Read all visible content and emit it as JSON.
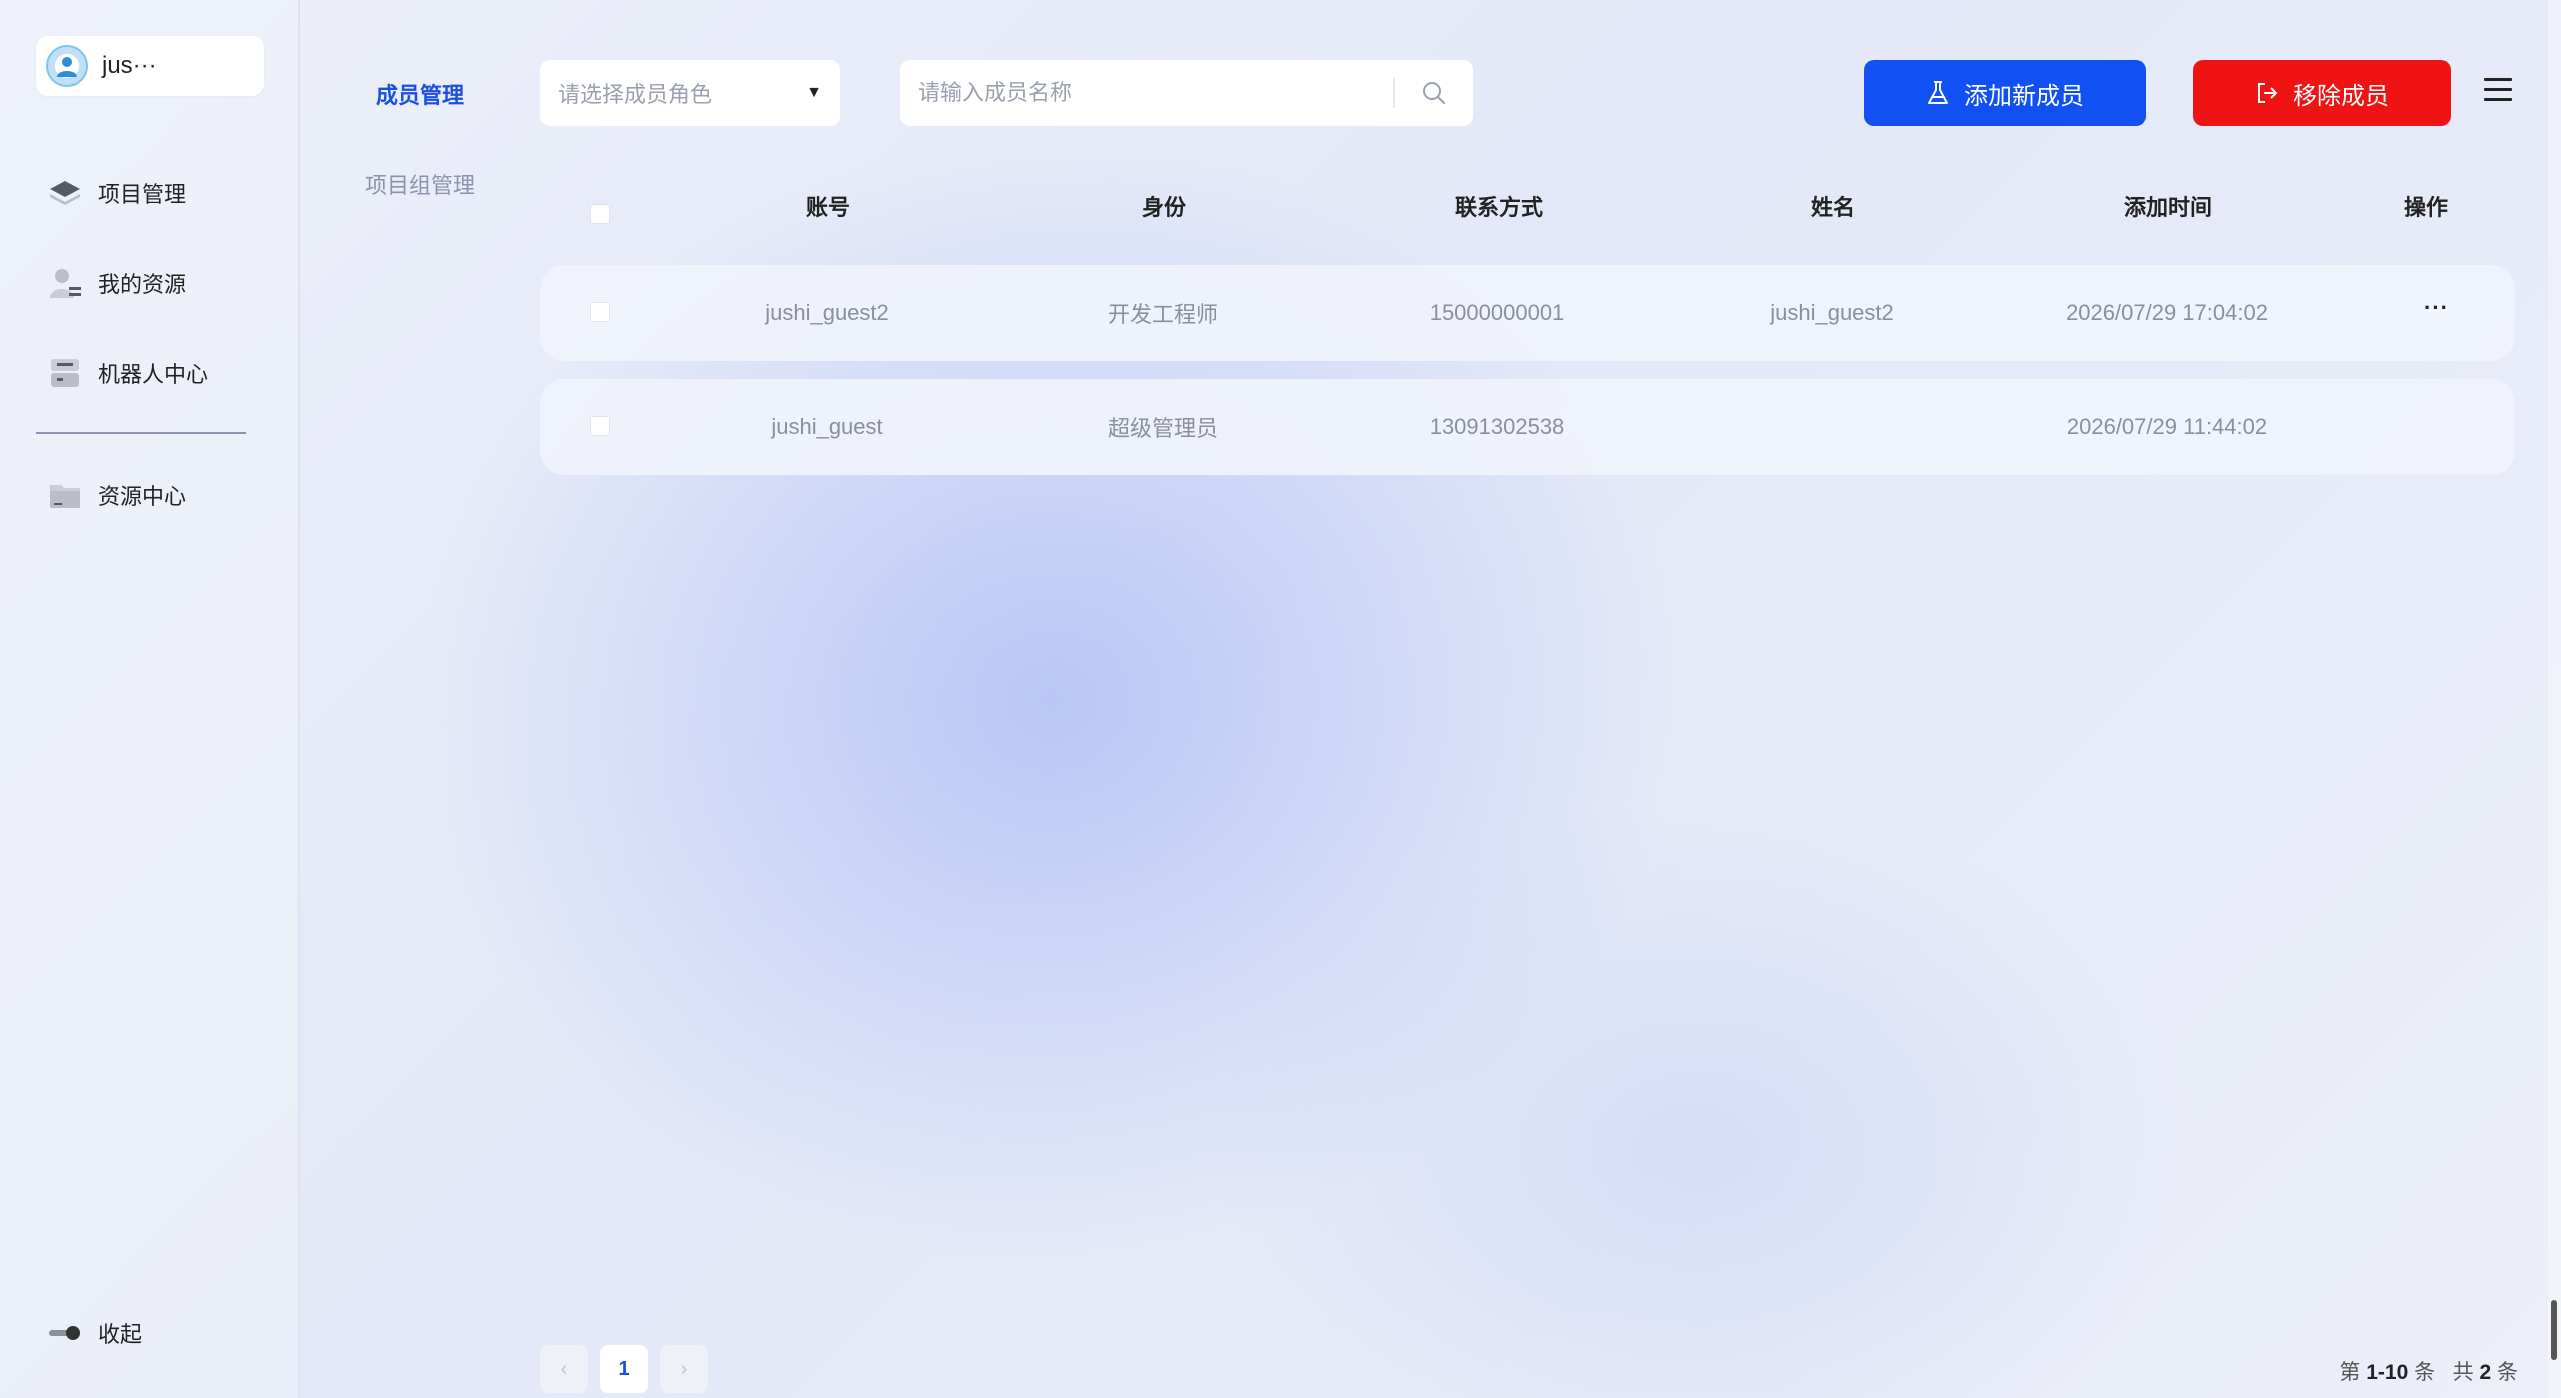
{
  "user": {
    "name": "jus···"
  },
  "sidebar": {
    "items": [
      {
        "label": "项目管理",
        "icon": "layers-icon"
      },
      {
        "label": "我的资源",
        "icon": "user-resource-icon"
      },
      {
        "label": "机器人中心",
        "icon": "robot-icon"
      },
      {
        "label": "资源中心",
        "icon": "folder-icon"
      }
    ],
    "collapse_label": "收起"
  },
  "sub_nav": {
    "items": [
      {
        "label": "成员管理",
        "active": true
      },
      {
        "label": "项目组管理",
        "active": false
      }
    ]
  },
  "toolbar": {
    "role_select_placeholder": "请选择成员角色",
    "search_placeholder": "请输入成员名称",
    "add_label": "添加新成员",
    "remove_label": "移除成员"
  },
  "table": {
    "columns": [
      "账号",
      "身份",
      "联系方式",
      "姓名",
      "添加时间",
      "操作"
    ],
    "rows": [
      {
        "account": "jushi_guest2",
        "role": "开发工程师",
        "contact": "15000000001",
        "name": "jushi_guest2",
        "added": "2026/07/29 17:04:02",
        "action": "···"
      },
      {
        "account": "jushi_guest",
        "role": "超级管理员",
        "contact": "13091302538",
        "name": "",
        "added": "2026/07/29 11:44:02",
        "action": ""
      }
    ]
  },
  "pagination": {
    "prev": "‹",
    "current": "1",
    "next": "›",
    "range_prefix": "第",
    "range": "1-10",
    "range_suffix": "条",
    "total_prefix": "共",
    "total": "2",
    "total_suffix": "条"
  },
  "colors": {
    "primary": "#1151f3",
    "danger": "#f01313",
    "active_text": "#1c4fe0"
  }
}
